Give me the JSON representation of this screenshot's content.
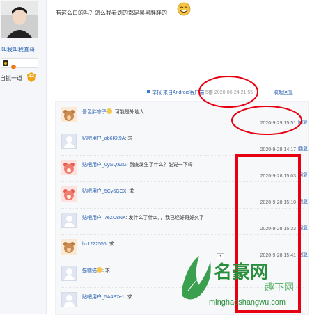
{
  "author": {
    "name": "叫我叫我查哥",
    "level_name": "自抓一道",
    "level": "12"
  },
  "post": {
    "text": "有这么白的吗？怎么我看到的都是黑黑胖胖的",
    "report_label": "举报",
    "source": "来自Android客户端",
    "floor": "5楼",
    "time": "2020-06-24 21:55",
    "reply_label": "收起回复"
  },
  "replies": [
    {
      "user": "吾色胖忘子",
      "text": ": 可能是外地人",
      "time": "2020-9-29 15:51",
      "reply": "回复",
      "avatar": "bear"
    },
    {
      "user": "贴吧用户_ab6KX9A",
      "text": ": 求",
      "time": "2020-9-28 14:17",
      "reply": "回复",
      "avatar": "blank"
    },
    {
      "user": "贴吧用户_0yGQaZG",
      "text": ": 到底发生了什么？能说一下吗",
      "time": "2020-9-28 15:03",
      "reply": "回复",
      "avatar": "red"
    },
    {
      "user": "贴吧用户_5Cy6GCX",
      "text": ": 求",
      "time": "2020-9-28 15:10",
      "reply": "回复",
      "avatar": "red"
    },
    {
      "user": "贴吧用户_7eZC8NK",
      "text": ": 发什么了什么。，我已经好奇好久了",
      "time": "2020-9-28 15:33",
      "reply": "回复",
      "avatar": "blank"
    },
    {
      "user": "hx1222555",
      "text": ": 求",
      "time": "2020-9-28 15:41",
      "reply": "回复",
      "avatar": "bear"
    },
    {
      "user": "猫糖猫",
      "text": ": 求",
      "time": "",
      "reply": "",
      "avatar": "blank"
    },
    {
      "user": "贴吧用户_5A4S7e1",
      "text": ": 求",
      "time": "",
      "reply": "",
      "avatar": "blank"
    }
  ],
  "watermark": {
    "title": "名豪网",
    "sub": "趣下网",
    "url": "minghaoshangwu.com"
  },
  "colors": {
    "link": "#2d64b3",
    "annotation_red": "#e60012",
    "watermark_green": "#2a8f3c"
  }
}
